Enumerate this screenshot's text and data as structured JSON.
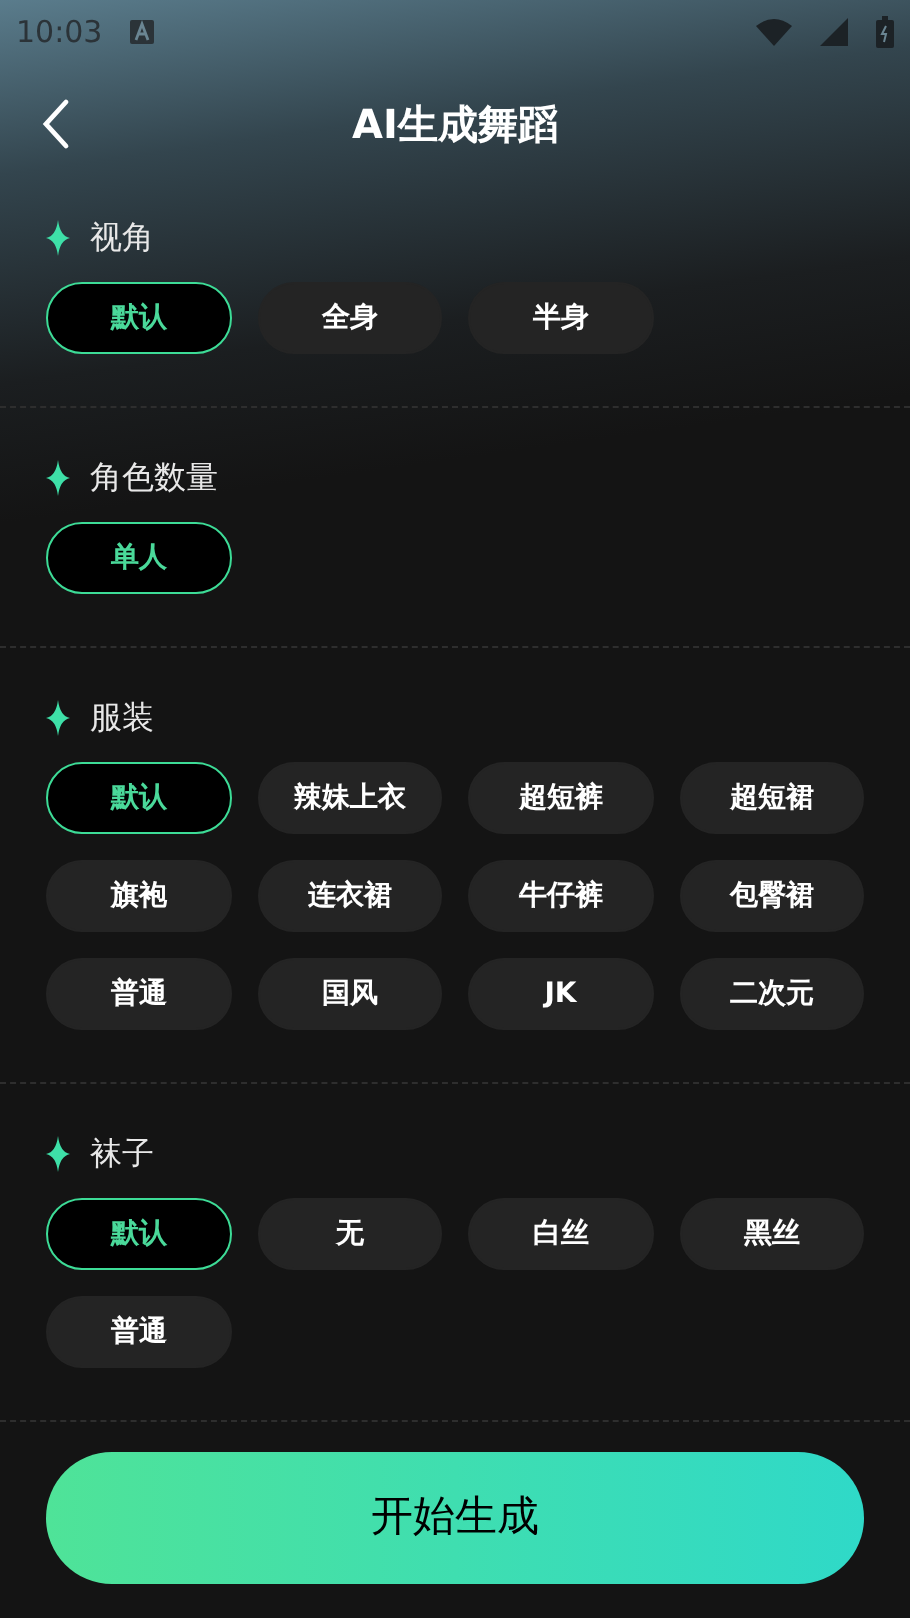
{
  "status_bar": {
    "time": "10:03"
  },
  "header": {
    "title": "AI生成舞蹈"
  },
  "sections": [
    {
      "title": "视角",
      "options": [
        {
          "label": "默认",
          "selected": true
        },
        {
          "label": "全身",
          "selected": false
        },
        {
          "label": "半身",
          "selected": false
        }
      ]
    },
    {
      "title": "角色数量",
      "options": [
        {
          "label": "单人",
          "selected": true
        }
      ]
    },
    {
      "title": "服装",
      "options": [
        {
          "label": "默认",
          "selected": true
        },
        {
          "label": "辣妹上衣",
          "selected": false
        },
        {
          "label": "超短裤",
          "selected": false
        },
        {
          "label": "超短裙",
          "selected": false
        },
        {
          "label": "旗袍",
          "selected": false
        },
        {
          "label": "连衣裙",
          "selected": false
        },
        {
          "label": "牛仔裤",
          "selected": false
        },
        {
          "label": "包臀裙",
          "selected": false
        },
        {
          "label": "普通",
          "selected": false
        },
        {
          "label": "国风",
          "selected": false
        },
        {
          "label": "JK",
          "selected": false
        },
        {
          "label": "二次元",
          "selected": false
        }
      ]
    },
    {
      "title": "袜子",
      "options": [
        {
          "label": "默认",
          "selected": true
        },
        {
          "label": "无",
          "selected": false
        },
        {
          "label": "白丝",
          "selected": false
        },
        {
          "label": "黑丝",
          "selected": false
        },
        {
          "label": "普通",
          "selected": false
        }
      ]
    }
  ],
  "generate_button": {
    "label": "开始生成"
  }
}
